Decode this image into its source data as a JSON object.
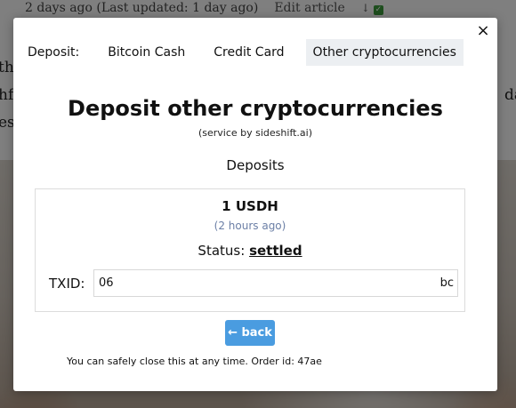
{
  "background_page": {
    "meta_date": "2 days ago (Last updated: 1 day ago)",
    "edit_link": "Edit article",
    "arrow_icon": "↓",
    "check_icon": "✓",
    "fragments_left": [
      "th",
      "hf",
      "es"
    ],
    "fragment_right": "da"
  },
  "modal": {
    "close_icon": "×",
    "tabs": {
      "label": "Deposit:",
      "items": [
        {
          "label": "Bitcoin Cash"
        },
        {
          "label": "Credit Card"
        },
        {
          "label": "Other cryptocurrencies"
        }
      ],
      "active_index": 2
    },
    "title": "Deposit other cryptocurrencies",
    "subtitle": "(service by sideshift.ai)",
    "deposits_heading": "Deposits",
    "deposit": {
      "amount": "1 USDH",
      "time_ago": "(2 hours ago)",
      "status_label": "Status:",
      "status_value": "settled",
      "txid_label": "TXID:",
      "txid_value_start": "06",
      "txid_value_end": "bc"
    },
    "back_button": "← back",
    "footer_note": "You can safely close this at any time. Order id: 47ae"
  },
  "colors": {
    "overlay": "#000000",
    "back_button": "#4a9ce0",
    "time_ago": "#6b7fa6",
    "active_tab": "#eceff2"
  }
}
